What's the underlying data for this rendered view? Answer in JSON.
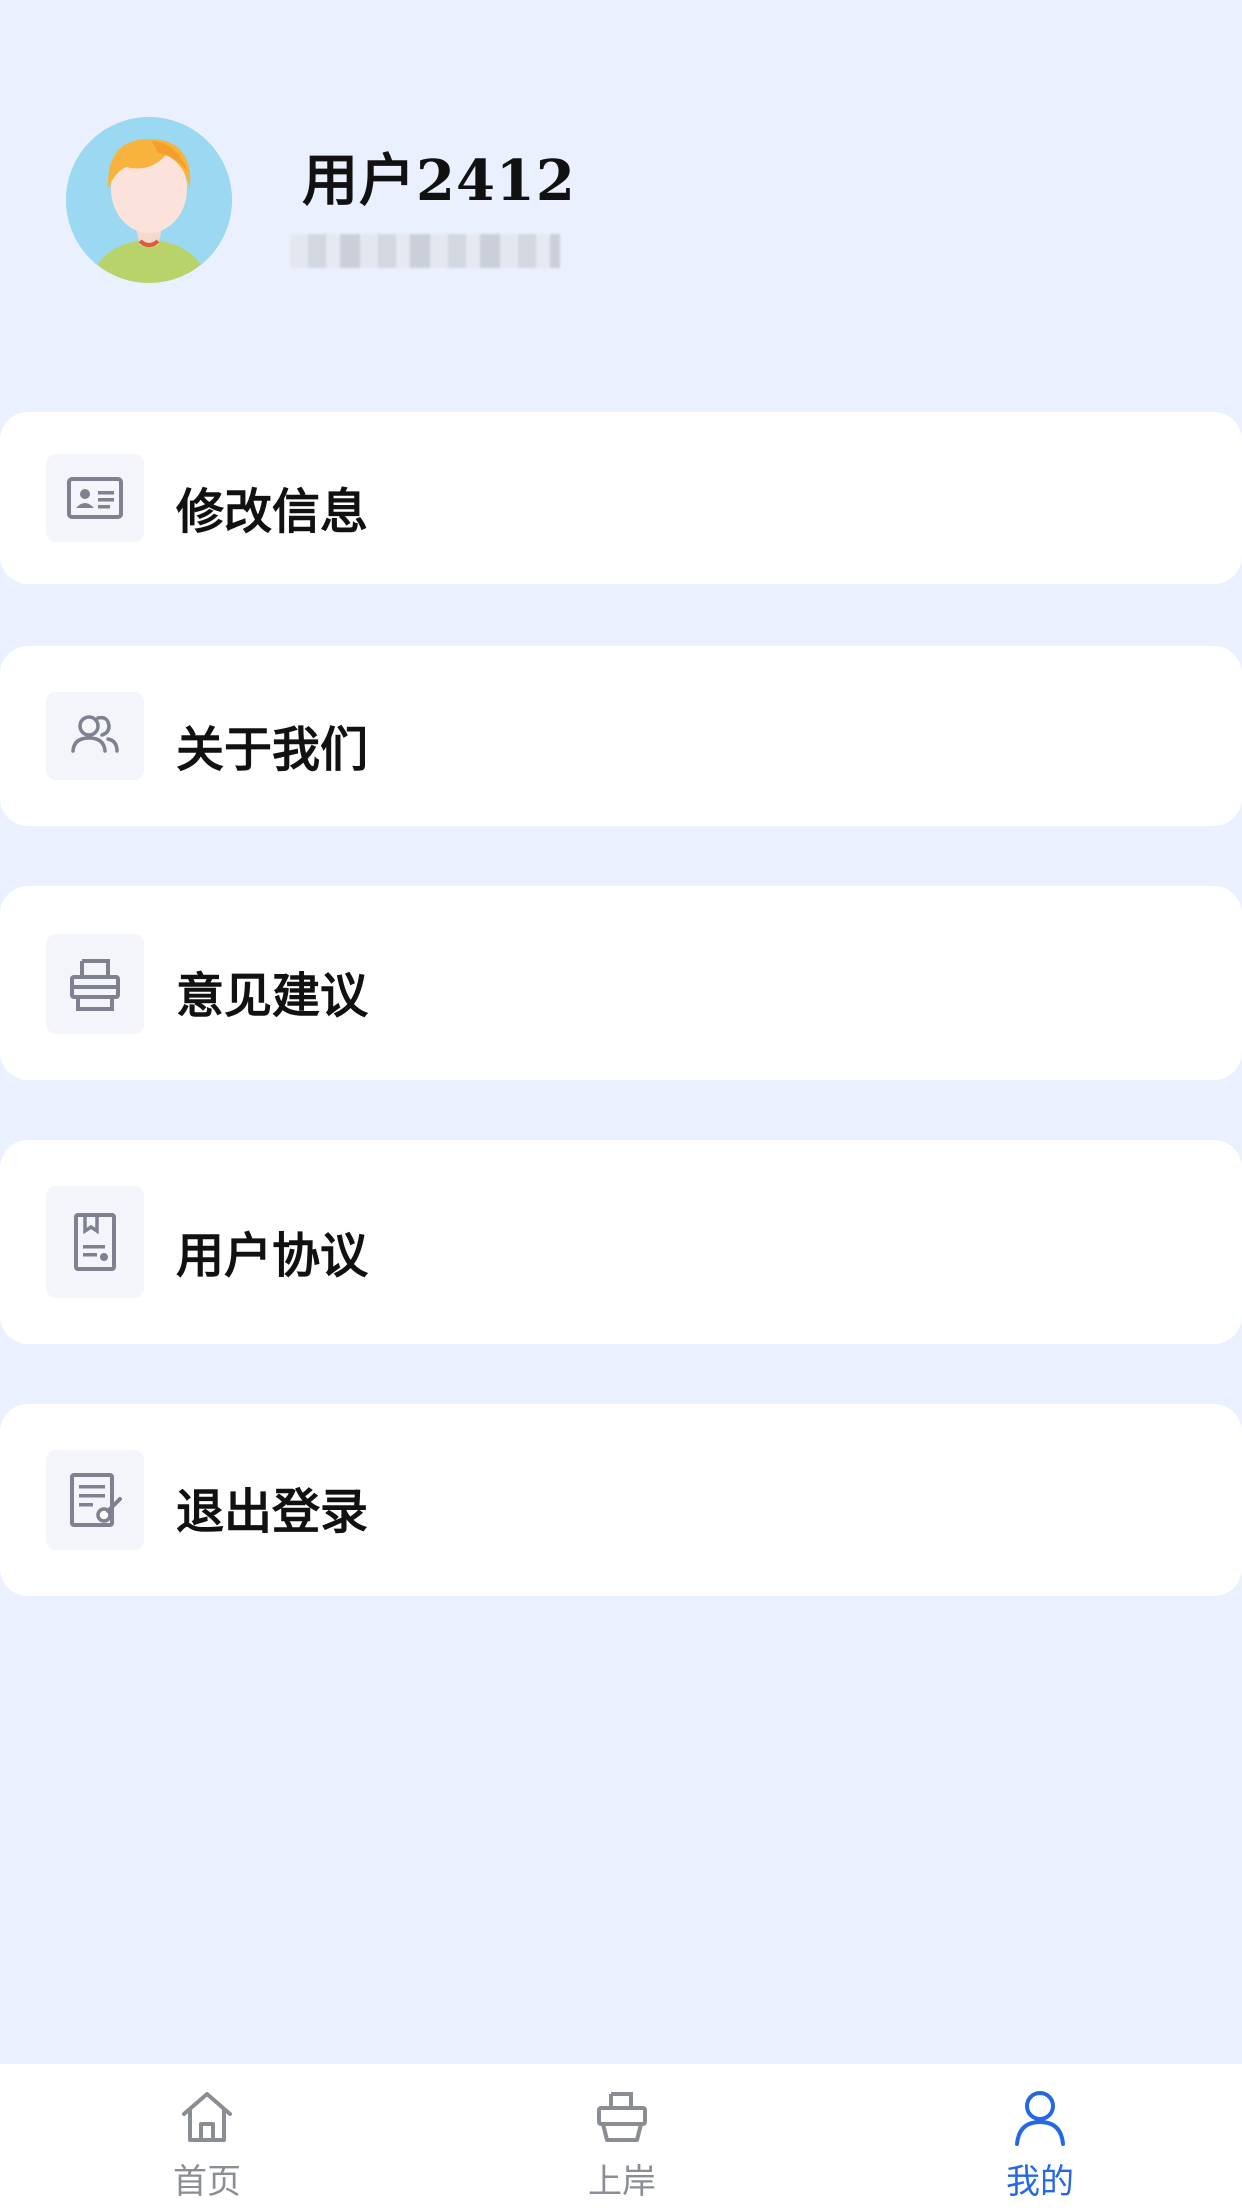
{
  "profile": {
    "username": "用户2412"
  },
  "menu": [
    {
      "label": "修改信息",
      "icon": "id-card-icon"
    },
    {
      "label": "关于我们",
      "icon": "users-icon"
    },
    {
      "label": "意见建议",
      "icon": "printer-icon"
    },
    {
      "label": "用户协议",
      "icon": "document-icon"
    },
    {
      "label": "退出登录",
      "icon": "document-edit-icon"
    }
  ],
  "tabbar": {
    "items": [
      {
        "label": "首页",
        "icon": "home-icon",
        "active": false
      },
      {
        "label": "上岸",
        "icon": "boat-icon",
        "active": false
      },
      {
        "label": "我的",
        "icon": "user-icon",
        "active": true
      }
    ],
    "active_color": "#2667e6",
    "inactive_color": "#8a8d94"
  },
  "colors": {
    "background": "#eaf0fd",
    "card": "#ffffff",
    "icon_gray": "#7d8190"
  }
}
